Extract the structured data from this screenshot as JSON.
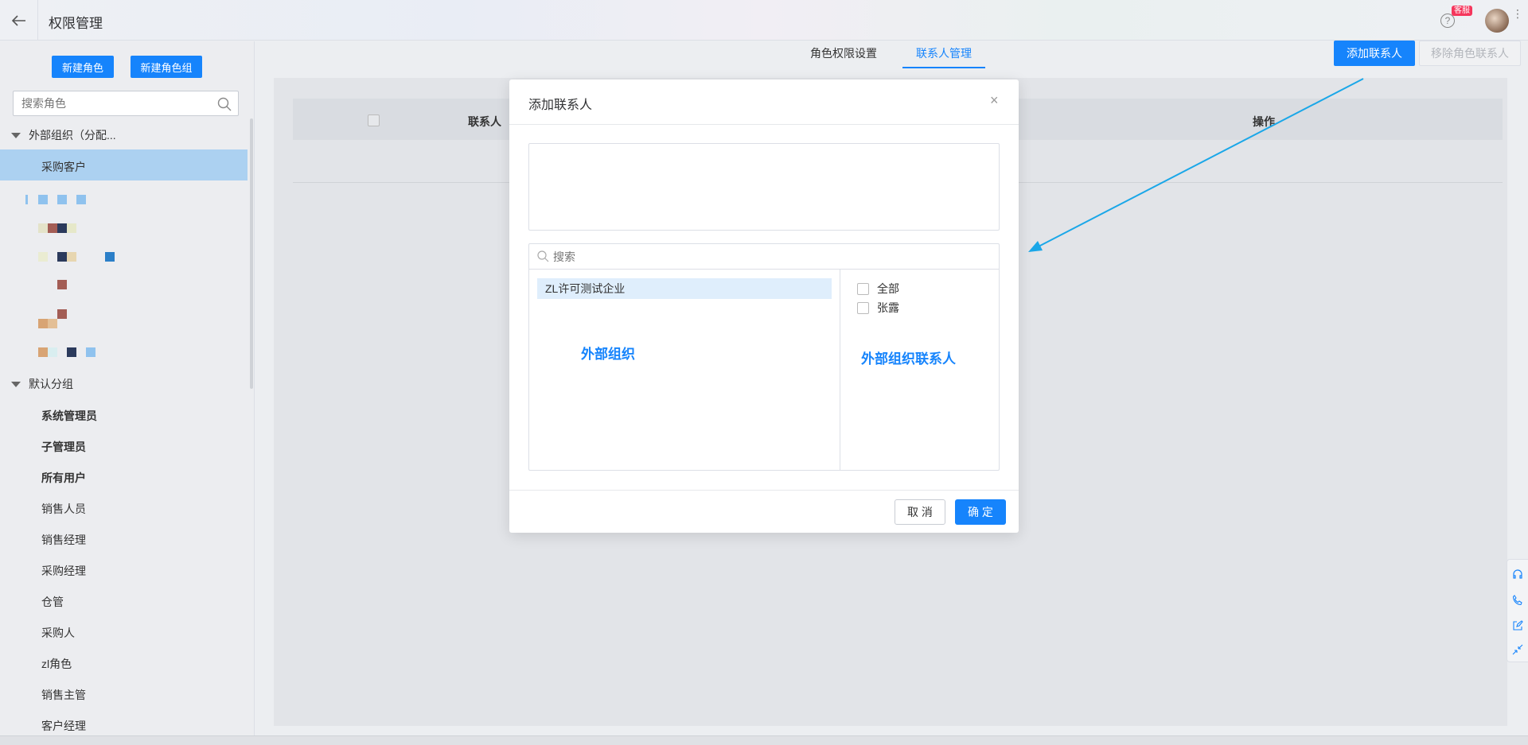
{
  "header": {
    "title": "权限管理",
    "help_glyph": "?",
    "badge": "客服",
    "more_glyph": "⋮"
  },
  "sidebar": {
    "new_role_label": "新建角色",
    "new_role_group_label": "新建角色组",
    "search_placeholder": "搜索角色",
    "group_external": "外部组织（分配...",
    "selected_role": "采购客户",
    "group_default": "默认分组",
    "roles": [
      "系统管理员",
      "子管理员",
      "所有用户",
      "销售人员",
      "销售经理",
      "采购经理",
      "仓管",
      "采购人",
      "zl角色",
      "销售主管",
      "客户经理"
    ]
  },
  "tabs": {
    "role_permission": "角色权限设置",
    "contact_manage": "联系人管理"
  },
  "toolbar": {
    "add_contact": "添加联系人",
    "remove_contact": "移除角色联系人"
  },
  "table": {
    "col_contact": "联系人",
    "col_action": "操作"
  },
  "dock": {
    "icons": [
      "headset-icon",
      "phone-icon",
      "edit-icon",
      "collapse-icon"
    ]
  },
  "modal": {
    "title": "添加联系人",
    "close": "×",
    "search_placeholder": "搜索",
    "org_item": "ZL许可测试企业",
    "ann_org": "外部组织",
    "ann_contacts": "外部组织联系人",
    "check_all": "全部",
    "contact_1": "张露",
    "cancel": "取 消",
    "ok": "确 定"
  },
  "colors": {
    "primary": "#1684fc",
    "selected_bg": "#acd1f1",
    "arrow": "#1aa7e8"
  }
}
